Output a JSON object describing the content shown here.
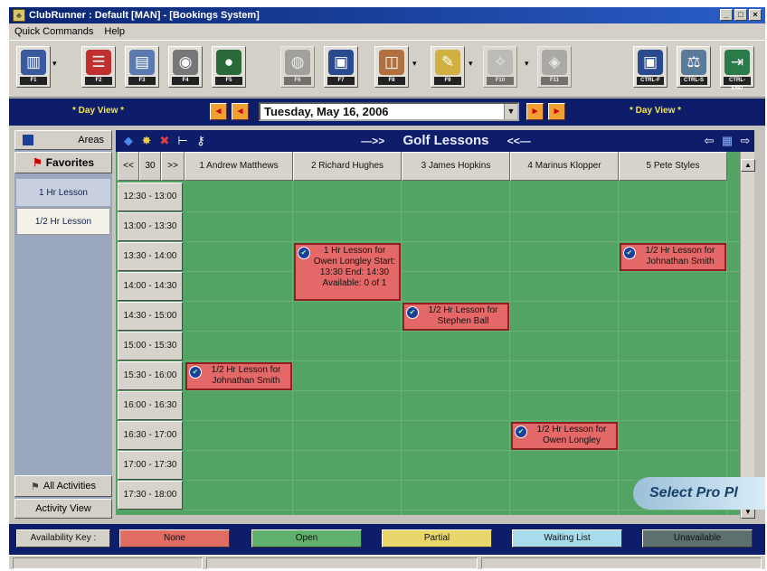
{
  "window": {
    "title": "ClubRunner : Default [MAN] - [Bookings System]",
    "controls": [
      "_",
      "□",
      "×"
    ]
  },
  "menu": [
    "Quick Commands",
    "Help"
  ],
  "toolbar": {
    "buttons": [
      {
        "icon": "building-icon",
        "key": "F1",
        "color": "#3a5aa0"
      },
      {
        "icon": "contacts-icon",
        "key": "F2",
        "color": "#c03030"
      },
      {
        "icon": "calendar-icon",
        "key": "F3",
        "color": "#5a7ab0"
      },
      {
        "icon": "eye-icon",
        "key": "F4",
        "color": "#777777"
      },
      {
        "icon": "globe-icon",
        "key": "F5",
        "color": "#2a6a3a"
      },
      {
        "icon": "coins-icon",
        "key": "F6",
        "color": "#7a7a7a"
      },
      {
        "icon": "register-icon",
        "key": "F7",
        "color": "#2a4a90"
      },
      {
        "icon": "basket-icon",
        "key": "F8",
        "color": "#b07040"
      },
      {
        "icon": "broom-icon",
        "key": "F9",
        "color": "#d0b040"
      },
      {
        "icon": "wand-icon",
        "key": "F10",
        "color": "#aaaaaa"
      },
      {
        "icon": "pin-icon",
        "key": "F11",
        "color": "#8a8a8a"
      },
      {
        "icon": "till-icon",
        "key": "CTRL-F",
        "color": "#2a4a90"
      },
      {
        "icon": "scale-icon",
        "key": "CTRL-S",
        "color": "#5a7a9a"
      },
      {
        "icon": "exit-door-icon",
        "key": "CTRL-END",
        "color": "#2a7a4a"
      }
    ]
  },
  "nav": {
    "day_view_left": "* Day View *",
    "day_view_right": "* Day View *",
    "date": "Tuesday, May 16, 2006"
  },
  "left_panel": {
    "areas": "Areas",
    "favorites": "Favorites",
    "items": [
      "1 Hr Lesson",
      "1/2 Hr Lesson"
    ],
    "all_activities": "All Activities",
    "activity_view": "Activity View"
  },
  "main": {
    "title": "Golf Lessons",
    "nav_prev": "<<",
    "interval": "30",
    "nav_next": ">>"
  },
  "columns": [
    "1 Andrew Matthews",
    "2 Richard Hughes",
    "3 James Hopkins",
    "4 Marinus Klopper",
    "5 Pete Styles"
  ],
  "times": [
    "12:30 - 13:00",
    "13:00 - 13:30",
    "13:30 - 14:00",
    "14:00 - 14:30",
    "14:30 - 15:00",
    "15:00 - 15:30",
    "15:30 - 16:00",
    "16:00 - 16:30",
    "16:30 - 17:00",
    "17:00 - 17:30",
    "17:30 - 18:00"
  ],
  "bookings": [
    {
      "col": 1,
      "row": 2,
      "span": 2,
      "text": "1 Hr Lesson for Owen Longley Start: 13:30 End: 14:30 Available: 0 of 1"
    },
    {
      "col": 4,
      "row": 2,
      "span": 1,
      "text": "1/2 Hr Lesson for Johnathan Smith"
    },
    {
      "col": 2,
      "row": 4,
      "span": 1,
      "text": "1/2 Hr Lesson for Stephen Ball"
    },
    {
      "col": 0,
      "row": 6,
      "span": 1,
      "text": "1/2 Hr Lesson for Johnathan Smith"
    },
    {
      "col": 3,
      "row": 8,
      "span": 1,
      "text": "1/2 Hr Lesson for Owen Longley"
    }
  ],
  "overlay": "Select Pro Pl",
  "availability_key": {
    "label": "Availability Key :",
    "items": [
      {
        "label": "None",
        "color": "#e06c62"
      },
      {
        "label": "Open",
        "color": "#5fb06c"
      },
      {
        "label": "Partial",
        "color": "#e8d66a"
      },
      {
        "label": "Waiting List",
        "color": "#a8dcec"
      },
      {
        "label": "Unavailable",
        "color": "#5e6f70"
      }
    ]
  }
}
